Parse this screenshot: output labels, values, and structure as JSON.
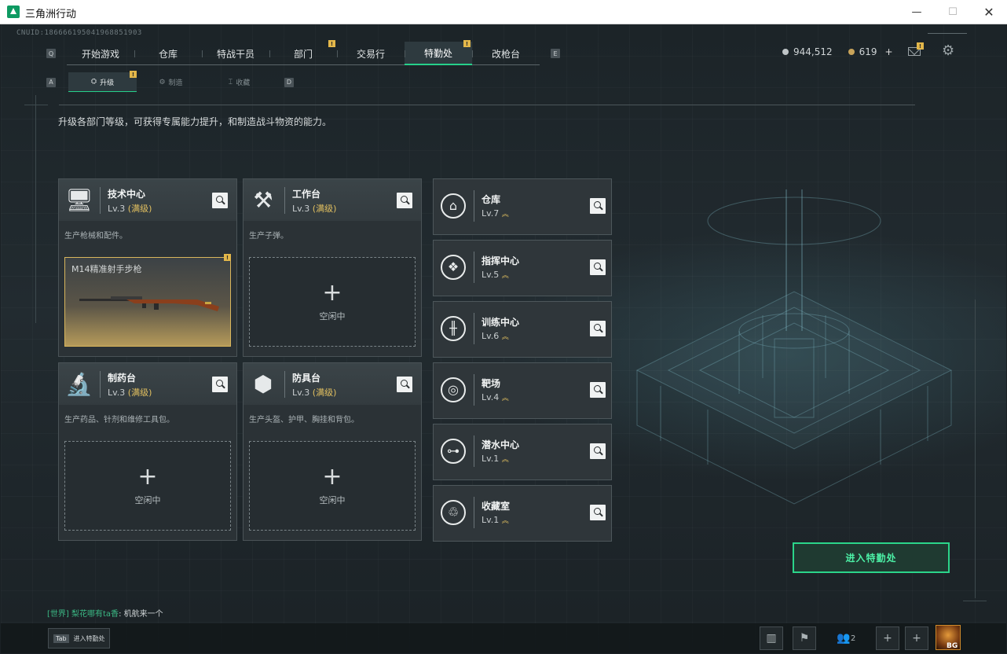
{
  "window": {
    "title": "三角洲行动",
    "min": "—",
    "max": "☐",
    "close": "✕"
  },
  "uid": "CNUID:186666195041968851903",
  "topnav": {
    "left_key": "Q",
    "right_key": "E",
    "tabs": [
      {
        "label": "开始游戏",
        "badge": ""
      },
      {
        "label": "仓库",
        "badge": ""
      },
      {
        "label": "特战干员",
        "badge": ""
      },
      {
        "label": "部门",
        "badge": "!"
      },
      {
        "label": "交易行",
        "badge": ""
      },
      {
        "label": "特勤处",
        "badge": "!"
      },
      {
        "label": "改枪台",
        "badge": ""
      }
    ]
  },
  "currency": {
    "silver": "944,512",
    "gold": "619",
    "plus": "+"
  },
  "mail_badge": "!",
  "subnav": {
    "left_key": "A",
    "right_key": "D",
    "tabs": [
      {
        "label": "升级",
        "icon": "⛭",
        "badge": "!"
      },
      {
        "label": "制造",
        "icon": "⚙",
        "badge": ""
      },
      {
        "label": "收藏",
        "icon": "⌶",
        "badge": ""
      }
    ]
  },
  "description": "升级各部门等级，可获得专属能力提升，和制造战斗物资的能力。",
  "production": [
    {
      "name": "技术中心",
      "level": "Lv.3",
      "max": "(满级)",
      "desc": "生产枪械和配件。",
      "icon": "🖥",
      "slot": {
        "state": "item",
        "item_name": "M14精准射手步枪",
        "badge": "!"
      }
    },
    {
      "name": "工作台",
      "level": "Lv.3",
      "max": "(满级)",
      "desc": "生产子弹。",
      "icon": "⚒",
      "slot": {
        "state": "empty",
        "plus": "+",
        "text": "空闲中"
      }
    },
    {
      "name": "制药台",
      "level": "Lv.3",
      "max": "(满级)",
      "desc": "生产药品、针剂和维修工具包。",
      "icon": "🔬",
      "slot": {
        "state": "empty",
        "plus": "+",
        "text": "空闲中"
      }
    },
    {
      "name": "防具台",
      "level": "Lv.3",
      "max": "(满级)",
      "desc": "生产头盔、护甲、胸挂和背包。",
      "icon": "⬢",
      "slot": {
        "state": "empty",
        "plus": "+",
        "text": "空闲中"
      }
    }
  ],
  "facilities": [
    {
      "name": "仓库",
      "level": "Lv.7",
      "up": "︽",
      "icon": "⌂"
    },
    {
      "name": "指挥中心",
      "level": "Lv.5",
      "up": "︽",
      "icon": "❖"
    },
    {
      "name": "训练中心",
      "level": "Lv.6",
      "up": "︽",
      "icon": "╫"
    },
    {
      "name": "靶场",
      "level": "Lv.4",
      "up": "︽",
      "icon": "◎"
    },
    {
      "name": "潜水中心",
      "level": "Lv.1",
      "up": "︽",
      "icon": "⊶"
    },
    {
      "name": "收藏室",
      "level": "Lv.1",
      "up": "︽",
      "icon": "♲"
    }
  ],
  "enter_button": "进入特勤处",
  "chat": {
    "channel": "[世界]",
    "user": "梨花哪有ta香",
    "message": ": 机航来一个"
  },
  "bottom": {
    "tab_key": "Tab",
    "tab_label": "进入特勤处",
    "friends_count": "2",
    "avatar_tag": "BG"
  },
  "colors": {
    "accent": "#26d08a",
    "gold": "#e2c060",
    "badge": "#e3b74a"
  }
}
